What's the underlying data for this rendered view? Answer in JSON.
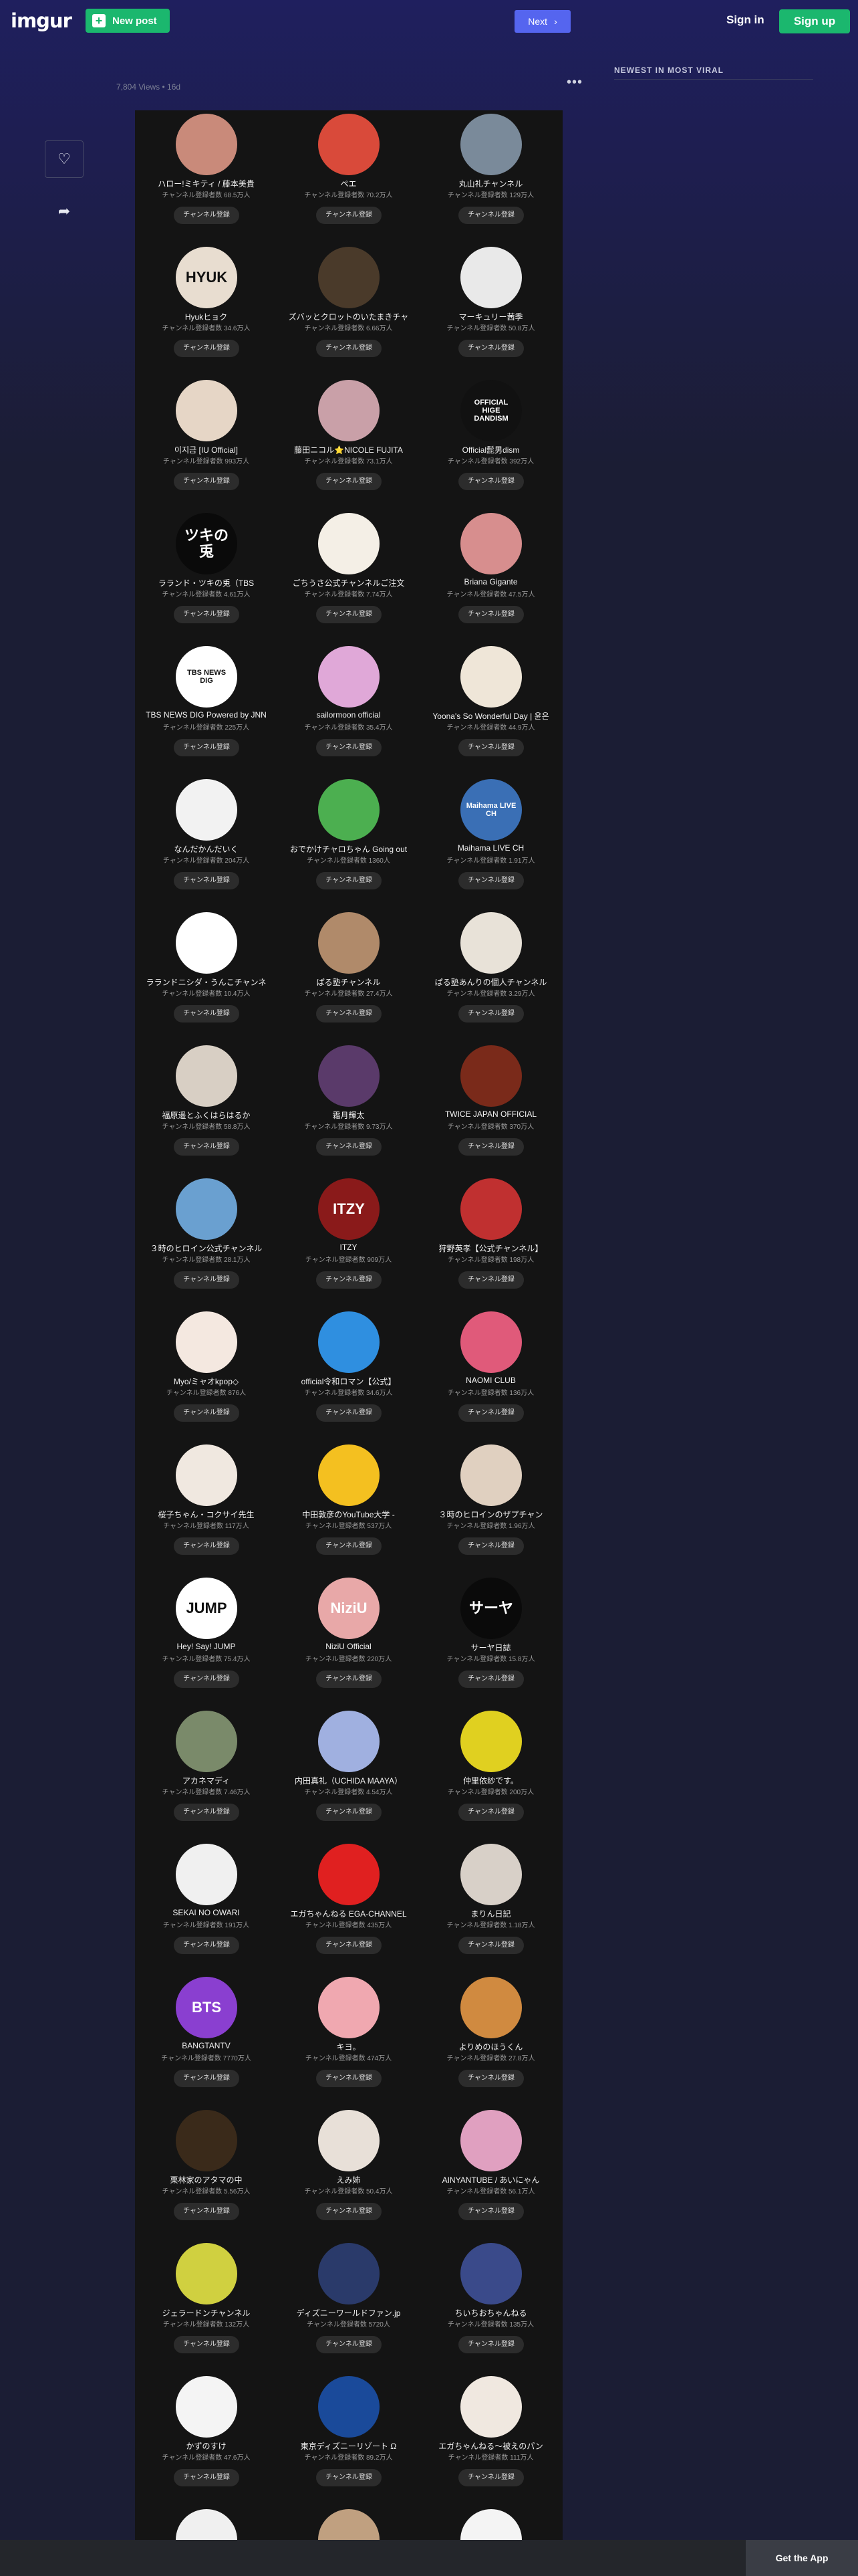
{
  "header": {
    "logo": "imgur",
    "new_post_label": "New post",
    "next_label": "Next",
    "signin_label": "Sign in",
    "signup_label": "Sign up"
  },
  "post_meta": {
    "views": "7,804 Views",
    "separator": "•",
    "age": "16d"
  },
  "more_menu": "•••",
  "sidebar": {
    "title": "NEWEST IN MOST VIRAL"
  },
  "footer": {
    "get_app_label": "Get the App"
  },
  "colors": {
    "accent_green": "#1bb76e",
    "accent_blue": "#5565ef",
    "background": "#1b1d34"
  },
  "channels": [
    {
      "name": "ハロー!ミキティ / 藤本美貴",
      "subs": "チャンネル登録者数 68.5万人",
      "btn": "チャンネル登録",
      "color": "#c98a7a",
      "label": ""
    },
    {
      "name": "ペエ",
      "subs": "チャンネル登録者数 70.2万人",
      "btn": "チャンネル登録",
      "color": "#d94a3a",
      "label": ""
    },
    {
      "name": "丸山礼チャンネル",
      "subs": "チャンネル登録者数 129万人",
      "btn": "チャンネル登録",
      "color": "#7a8a9a",
      "label": ""
    },
    {
      "name": "Hyukヒョク",
      "subs": "チャンネル登録者数 34.6万人",
      "btn": "チャンネル登録",
      "color": "#e8ddd0",
      "label": "HYUK"
    },
    {
      "name": "ズバッとクロットのいたまきチャ",
      "subs": "チャンネル登録者数 6.66万人",
      "btn": "チャンネル登録",
      "color": "#4a3a2a",
      "label": ""
    },
    {
      "name": "マーキュリー茜季",
      "subs": "チャンネル登録者数 50.8万人",
      "btn": "チャンネル登録",
      "color": "#e9e9e9",
      "label": ""
    },
    {
      "name": "이지금 [IU Official]",
      "subs": "チャンネル登録者数 993万人",
      "btn": "チャンネル登録",
      "color": "#e6d6c6",
      "label": ""
    },
    {
      "name": "藤田ニコル⭐NICOLE FUJITA",
      "subs": "チャンネル登録者数 73.1万人",
      "btn": "チャンネル登録",
      "color": "#c9a0a8",
      "label": ""
    },
    {
      "name": "Official髭男dism",
      "subs": "チャンネル登録者数 392万人",
      "btn": "チャンネル登録",
      "color": "#111111",
      "label": "OFFICIAL HIGE DANDISM"
    },
    {
      "name": "ラランド・ツキの兎（TBS",
      "subs": "チャンネル登録者数 4.61万人",
      "btn": "チャンネル登録",
      "color": "#0a0a0a",
      "label": "ツキの兎"
    },
    {
      "name": "ごちうさ公式チャンネルご注文",
      "subs": "チャンネル登録者数 7.74万人",
      "btn": "チャンネル登録",
      "color": "#f4efe6",
      "label": ""
    },
    {
      "name": "Briana Gigante",
      "subs": "チャンネル登録者数 47.5万人",
      "btn": "チャンネル登録",
      "color": "#d78e8e",
      "label": ""
    },
    {
      "name": "TBS NEWS DIG Powered by JNN",
      "subs": "チャンネル登録者数 225万人",
      "btn": "チャンネル登録",
      "color": "#ffffff",
      "label": "TBS NEWS DIG"
    },
    {
      "name": "sailormoon official",
      "subs": "チャンネル登録者数 35.4万人",
      "btn": "チャンネル登録",
      "color": "#e0a8d8",
      "label": ""
    },
    {
      "name": "Yoona's So Wonderful Day | 윤은",
      "subs": "チャンネル登録者数 44.9万人",
      "btn": "チャンネル登録",
      "color": "#efe6d8",
      "label": ""
    },
    {
      "name": "なんだかんだいく",
      "subs": "チャンネル登録者数 204万人",
      "btn": "チャンネル登録",
      "color": "#f2f2f2",
      "label": ""
    },
    {
      "name": "おでかけチャロちゃん Going out",
      "subs": "チャンネル登録者数 1360人",
      "btn": "チャンネル登録",
      "color": "#4caf50",
      "label": ""
    },
    {
      "name": "Maihama LIVE CH",
      "subs": "チャンネル登録者数 1.91万人",
      "btn": "チャンネル登録",
      "color": "#3a6fb5",
      "label": "Maihama LIVE CH"
    },
    {
      "name": "ラランドニシダ・うんこチャンネ",
      "subs": "チャンネル登録者数 10.4万人",
      "btn": "チャンネル登録",
      "color": "#ffffff",
      "label": ""
    },
    {
      "name": "ぱる塾チャンネル",
      "subs": "チャンネル登録者数 27.4万人",
      "btn": "チャンネル登録",
      "color": "#b08a6a",
      "label": ""
    },
    {
      "name": "ぱる塾あんりの個人チャンネル",
      "subs": "チャンネル登録者数 3.29万人",
      "btn": "チャンネル登録",
      "color": "#e8e2d8",
      "label": ""
    },
    {
      "name": "福原遥とふくはらはるか",
      "subs": "チャンネル登録者数 58.8万人",
      "btn": "チャンネル登録",
      "color": "#d8cfc4",
      "label": ""
    },
    {
      "name": "霜月輝太",
      "subs": "チャンネル登録者数 9.73万人",
      "btn": "チャンネル登録",
      "color": "#5a3a6a",
      "label": ""
    },
    {
      "name": "TWICE JAPAN OFFICIAL",
      "subs": "チャンネル登録者数 370万人",
      "btn": "チャンネル登録",
      "color": "#7a2a1a",
      "label": ""
    },
    {
      "name": "３時のヒロイン公式チャンネル",
      "subs": "チャンネル登録者数 28.1万人",
      "btn": "チャンネル登録",
      "color": "#6aa0d0",
      "label": ""
    },
    {
      "name": "ITZY",
      "subs": "チャンネル登録者数 909万人",
      "btn": "チャンネル登録",
      "color": "#8a1a1a",
      "label": "ITZY"
    },
    {
      "name": "狩野英孝【公式チャンネル】",
      "subs": "チャンネル登録者数 198万人",
      "btn": "チャンネル登録",
      "color": "#c03030",
      "label": ""
    },
    {
      "name": "Myo/ミャオkpop◇",
      "subs": "チャンネル登録者数 876人",
      "btn": "チャンネル登録",
      "color": "#f4e8e0",
      "label": ""
    },
    {
      "name": "official令和ロマン【公式】",
      "subs": "チャンネル登録者数 34.6万人",
      "btn": "チャンネル登録",
      "color": "#2f8fe0",
      "label": ""
    },
    {
      "name": "NAOMI CLUB",
      "subs": "チャンネル登録者数 136万人",
      "btn": "チャンネル登録",
      "color": "#e05a7a",
      "label": ""
    },
    {
      "name": "桜子ちゃん・コクサイ先生",
      "subs": "チャンネル登録者数 117万人",
      "btn": "チャンネル登録",
      "color": "#f0e8e0",
      "label": ""
    },
    {
      "name": "中田敦彦のYouTube大学 -",
      "subs": "チャンネル登録者数 537万人",
      "btn": "チャンネル登録",
      "color": "#f4c020",
      "label": ""
    },
    {
      "name": "３時のヒロインのザプチャン",
      "subs": "チャンネル登録者数 1.96万人",
      "btn": "チャンネル登録",
      "color": "#e0d0c0",
      "label": ""
    },
    {
      "name": "Hey! Say! JUMP",
      "subs": "チャンネル登録者数 75.4万人",
      "btn": "チャンネル登録",
      "color": "#ffffff",
      "label": "JUMP"
    },
    {
      "name": "NiziU Official",
      "subs": "チャンネル登録者数 220万人",
      "btn": "チャンネル登録",
      "color": "#e8a8a8",
      "label": "NiziU"
    },
    {
      "name": "サーヤ日誌",
      "subs": "チャンネル登録者数 15.8万人",
      "btn": "チャンネル登録",
      "color": "#0a0a0a",
      "label": "サーヤ"
    },
    {
      "name": "アカネマディ",
      "subs": "チャンネル登録者数 7.46万人",
      "btn": "チャンネル登録",
      "color": "#7a8a6a",
      "label": ""
    },
    {
      "name": "内田真礼（UCHIDA MAAYA）",
      "subs": "チャンネル登録者数 4.54万人",
      "btn": "チャンネル登録",
      "color": "#a0b0e0",
      "label": ""
    },
    {
      "name": "仲里依紗です。",
      "subs": "チャンネル登録者数 200万人",
      "btn": "チャンネル登録",
      "color": "#e0d020",
      "label": ""
    },
    {
      "name": "SEKAI NO OWARI",
      "subs": "チャンネル登録者数 191万人",
      "btn": "チャンネル登録",
      "color": "#f0f0f0",
      "label": ""
    },
    {
      "name": "エガちゃんねる EGA-CHANNEL",
      "subs": "チャンネル登録者数 435万人",
      "btn": "チャンネル登録",
      "color": "#e02020",
      "label": ""
    },
    {
      "name": "まりん日記",
      "subs": "チャンネル登録者数 1.18万人",
      "btn": "チャンネル登録",
      "color": "#d8d0c8",
      "label": ""
    },
    {
      "name": "BANGTANTV",
      "subs": "チャンネル登録者数 7770万人",
      "btn": "チャンネル登録",
      "color": "#8a3fd0",
      "label": "BTS"
    },
    {
      "name": "キヨ。",
      "subs": "チャンネル登録者数 474万人",
      "btn": "チャンネル登録",
      "color": "#f0a8b0",
      "label": ""
    },
    {
      "name": "よりめのほうくん",
      "subs": "チャンネル登録者数 27.8万人",
      "btn": "チャンネル登録",
      "color": "#d08a40",
      "label": ""
    },
    {
      "name": "栗林家のアタマの中",
      "subs": "チャンネル登録者数 5.56万人",
      "btn": "チャンネル登録",
      "color": "#3a2a1a",
      "label": ""
    },
    {
      "name": "えみ姉",
      "subs": "チャンネル登録者数 50.4万人",
      "btn": "チャンネル登録",
      "color": "#e8e0d8",
      "label": ""
    },
    {
      "name": "AINYANTUBE / あいにゃん",
      "subs": "チャンネル登録者数 56.1万人",
      "btn": "チャンネル登録",
      "color": "#e0a0c0",
      "label": ""
    },
    {
      "name": "ジェラードンチャンネル",
      "subs": "チャンネル登録者数 132万人",
      "btn": "チャンネル登録",
      "color": "#d0d040",
      "label": ""
    },
    {
      "name": "ディズニーワールドファン.jp",
      "subs": "チャンネル登録者数 5720人",
      "btn": "チャンネル登録",
      "color": "#2a3a6a",
      "label": ""
    },
    {
      "name": "ちいちおちゃんねる",
      "subs": "チャンネル登録者数 135万人",
      "btn": "チャンネル登録",
      "color": "#3a4a8a",
      "label": ""
    },
    {
      "name": "かずのすけ",
      "subs": "チャンネル登録者数 47.6万人",
      "btn": "チャンネル登録",
      "color": "#f4f4f4",
      "label": ""
    },
    {
      "name": "東京ディズニーリゾート Ω",
      "subs": "チャンネル登録者数 89.2万人",
      "btn": "チャンネル登録",
      "color": "#1a4a9a",
      "label": ""
    },
    {
      "name": "エガちゃんねる～被えのパン",
      "subs": "チャンネル登録者数 111万人",
      "btn": "チャンネル登録",
      "color": "#f0e8e0",
      "label": ""
    },
    {
      "name": "",
      "subs": "",
      "btn": "",
      "color": "#f0f0f0",
      "label": ""
    },
    {
      "name": "",
      "subs": "",
      "btn": "",
      "color": "#c0a080",
      "label": ""
    },
    {
      "name": "",
      "subs": "",
      "btn": "",
      "color": "#f4f4f4",
      "label": ""
    }
  ]
}
